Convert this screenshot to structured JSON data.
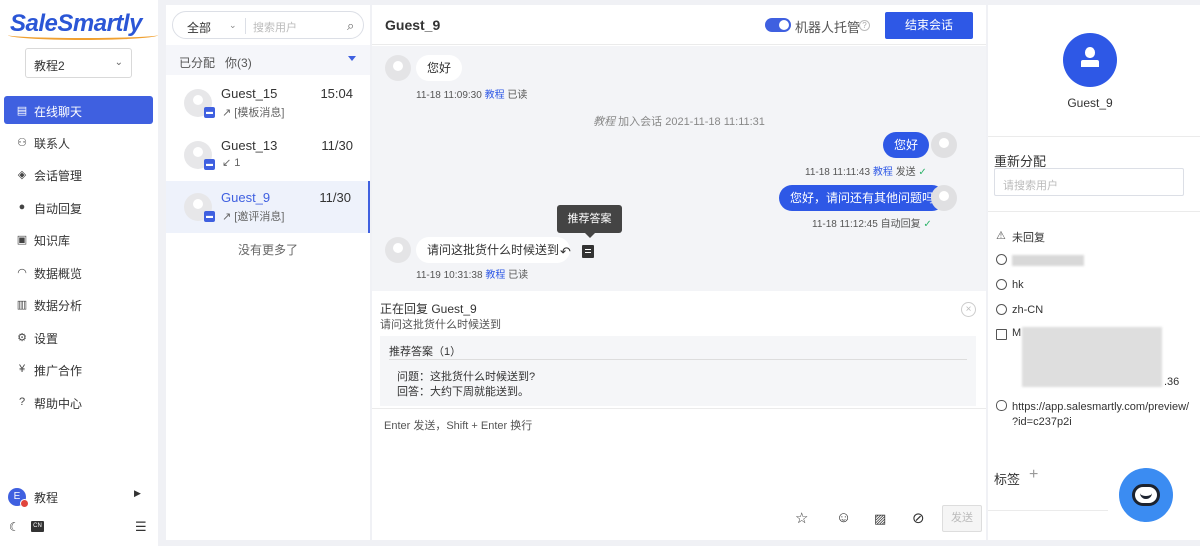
{
  "brand": {
    "logo": "SaleSmartly"
  },
  "workspace": {
    "name": "教程2"
  },
  "nav": {
    "items": [
      {
        "label": "在线聊天",
        "icon": "chat-icon"
      },
      {
        "label": "联系人",
        "icon": "contacts-icon"
      },
      {
        "label": "会话管理",
        "icon": "layers-icon"
      },
      {
        "label": "自动回复",
        "icon": "robot-icon"
      },
      {
        "label": "知识库",
        "icon": "book-icon"
      },
      {
        "label": "数据概览",
        "icon": "dashboard-icon"
      },
      {
        "label": "数据分析",
        "icon": "bar-chart-icon"
      },
      {
        "label": "设置",
        "icon": "gear-icon"
      },
      {
        "label": "推广合作",
        "icon": "yen-icon"
      },
      {
        "label": "帮助中心",
        "icon": "help-icon"
      }
    ],
    "user": {
      "name": "教程",
      "avatar_letter": "E"
    },
    "lang_badge": "CN"
  },
  "list": {
    "filter": {
      "selected": "全部",
      "placeholder": "搜索用户"
    },
    "section": {
      "label": "已分配",
      "count_label": "你(3)"
    },
    "conversations": [
      {
        "name": "Guest_15",
        "sub": "↗ [模板消息]",
        "time": "15:04"
      },
      {
        "name": "Guest_13",
        "sub": "↙ 1",
        "time": "11/30"
      },
      {
        "name": "Guest_9",
        "sub": "↗ [邀评消息]",
        "time": "11/30"
      }
    ],
    "no_more": "没有更多了"
  },
  "chat": {
    "title": "Guest_9",
    "robot_toggle_label": "机器人托管",
    "robot_toggle_on": true,
    "end_button": "结束会话",
    "messages": [
      {
        "text": "您好",
        "time": "11-18 11:09:30",
        "agent": "教程",
        "status": "已读"
      },
      {
        "text": "您好",
        "time": "11-18 11:11:43",
        "agent": "教程",
        "status": "发送"
      },
      {
        "text": "您好，请问还有其他问题吗",
        "time": "11-18 11:12:45",
        "agent": "自动回复"
      },
      {
        "text": "请问这批货什么时候送到",
        "time": "11-19 10:31:38",
        "agent": "教程",
        "status": "已读"
      }
    ],
    "system_event": {
      "agent": "教程",
      "text": "加入会话 2021-11-18 11:11:31"
    },
    "tooltip": "推荐答案",
    "reply": {
      "title": "正在回复 Guest_9",
      "quoted": "请问这批货什么时候送到",
      "suggest_title": "推荐答案（1）",
      "question": "问题：这批货什么时候送到?",
      "answer": "回答：大约下周就能送到。"
    },
    "input_placeholder": "Enter 发送，Shift + Enter 换行",
    "send_button": "发送"
  },
  "profile": {
    "name": "Guest_9",
    "reassign_label": "重新分配",
    "reassign_placeholder": "请搜索用户",
    "status": "未回复",
    "region": "hk",
    "language": "zh-CN",
    "device_prefix": "M",
    "device_suffix": ".36",
    "url": "https://app.salesmartly.com/preview/?id=c237p2i",
    "url_line1": "https://app.salesmartly.com/preview/",
    "url_line2": "?id=c237p2i",
    "tags_label": "标签"
  }
}
